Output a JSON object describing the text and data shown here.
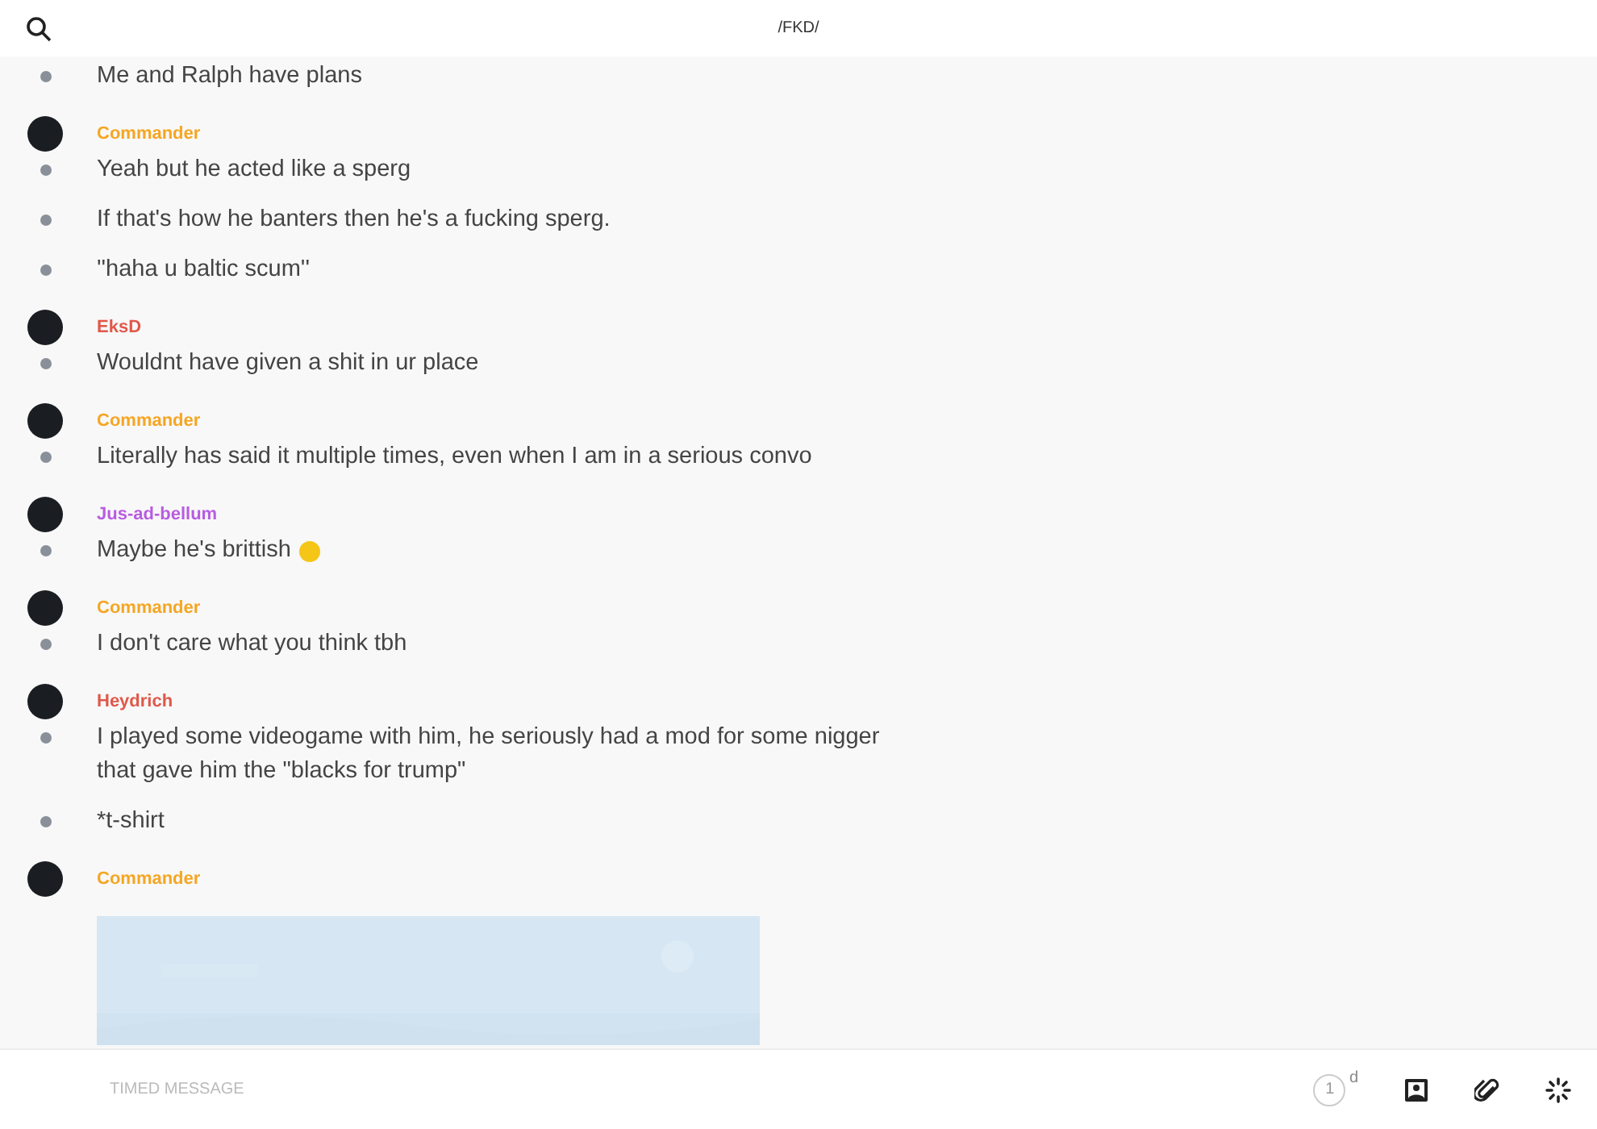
{
  "header": {
    "title": "/FKD/"
  },
  "groups": [
    {
      "messages": [
        "Me and Ralph have plans"
      ]
    },
    {
      "author": "Commander",
      "color": "#f5a623",
      "messages": [
        "Yeah but he acted like a sperg",
        "If that's how he banters then he's a fucking sperg.",
        "''haha u baltic scum''"
      ]
    },
    {
      "author": "EksD",
      "color": "#e0584a",
      "messages": [
        "Wouldnt have given a shit in ur place"
      ]
    },
    {
      "author": "Commander",
      "color": "#f5a623",
      "messages": [
        "Literally has said it multiple times, even when I am in a serious convo"
      ]
    },
    {
      "author": "Jus-ad-bellum",
      "color": "#b85ce0",
      "messages": [
        "Maybe he's brittish"
      ],
      "emoji": true
    },
    {
      "author": "Commander",
      "color": "#f5a623",
      "messages": [
        "I don't care what you think tbh"
      ]
    },
    {
      "author": "Heydrich",
      "color": "#e0584a",
      "messages": [
        "I played some videogame with him, he seriously had a mod for some nigger that gave him the \"blacks for trump\"",
        "*t-shirt"
      ]
    },
    {
      "author": "Commander",
      "color": "#f5a623"
    }
  ],
  "composer": {
    "placeholder": "TIMED MESSAGE",
    "timer": "1",
    "timer_unit": "d"
  }
}
